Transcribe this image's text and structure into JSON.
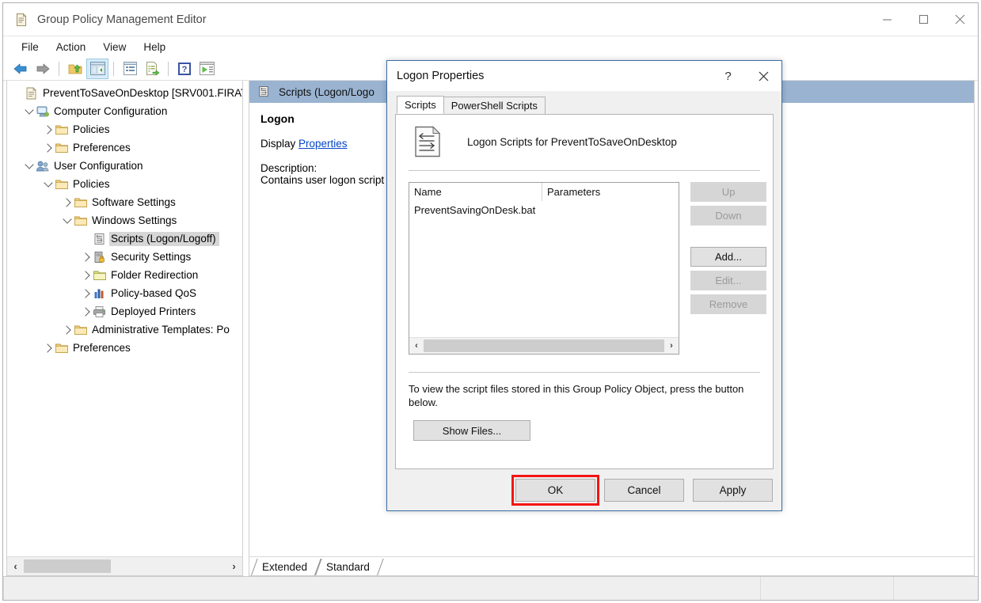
{
  "window": {
    "title": "Group Policy Management Editor",
    "icon": "policy-document-icon",
    "minimize_label": "–",
    "maximize_label": "□",
    "close_label": "✕"
  },
  "menubar": {
    "items": [
      {
        "label": "File",
        "name": "menu-file"
      },
      {
        "label": "Action",
        "name": "menu-action"
      },
      {
        "label": "View",
        "name": "menu-view"
      },
      {
        "label": "Help",
        "name": "menu-help"
      }
    ]
  },
  "toolbar": {
    "buttons": [
      {
        "name": "back-button",
        "icon": "back-arrow-icon"
      },
      {
        "name": "forward-button",
        "icon": "forward-arrow-icon"
      },
      {
        "name": "up-one-level-button",
        "icon": "up-folder-icon"
      },
      {
        "name": "show-hide-tree-button",
        "icon": "console-tree-icon"
      },
      {
        "name": "properties-button",
        "icon": "properties-window-icon"
      },
      {
        "name": "export-list-button",
        "icon": "export-list-icon"
      },
      {
        "name": "help-button",
        "icon": "help-question-icon"
      },
      {
        "name": "show-action-pane-button",
        "icon": "action-pane-icon"
      }
    ]
  },
  "tree": {
    "items": [
      {
        "label": "PreventToSaveOnDesktop [SRV001.FIRAT",
        "depth": 0,
        "twisty": "none",
        "icon": "gpo-document-icon",
        "selected": false
      },
      {
        "label": "Computer Configuration",
        "depth": 1,
        "twisty": "down",
        "icon": "computer-icon",
        "selected": false
      },
      {
        "label": "Policies",
        "depth": 2,
        "twisty": "right",
        "icon": "folder-icon",
        "selected": false
      },
      {
        "label": "Preferences",
        "depth": 2,
        "twisty": "right",
        "icon": "folder-icon",
        "selected": false
      },
      {
        "label": "User Configuration",
        "depth": 1,
        "twisty": "down",
        "icon": "users-icon",
        "selected": false
      },
      {
        "label": "Policies",
        "depth": 2,
        "twisty": "down",
        "icon": "folder-icon",
        "selected": false
      },
      {
        "label": "Software Settings",
        "depth": 3,
        "twisty": "right",
        "icon": "folder-icon",
        "selected": false
      },
      {
        "label": "Windows Settings",
        "depth": 3,
        "twisty": "down",
        "icon": "folder-icon",
        "selected": false
      },
      {
        "label": "Scripts (Logon/Logoff)",
        "depth": 4,
        "twisty": "none",
        "icon": "scripts-icon",
        "selected": true
      },
      {
        "label": "Security Settings",
        "depth": 4,
        "twisty": "right",
        "icon": "security-lock-icon",
        "selected": false
      },
      {
        "label": "Folder Redirection",
        "depth": 4,
        "twisty": "right",
        "icon": "folder-icon",
        "selected": false
      },
      {
        "label": "Policy-based QoS",
        "depth": 4,
        "twisty": "right",
        "icon": "bar-chart-icon",
        "selected": false
      },
      {
        "label": "Deployed Printers",
        "depth": 4,
        "twisty": "right",
        "icon": "printer-icon",
        "selected": false
      },
      {
        "label": "Administrative Templates: Po",
        "depth": 3,
        "twisty": "right",
        "icon": "folder-icon",
        "selected": false
      },
      {
        "label": "Preferences",
        "depth": 2,
        "twisty": "right",
        "icon": "folder-icon",
        "selected": false
      }
    ],
    "hscroll": {
      "left_arrow": "‹",
      "right_arrow": "›"
    }
  },
  "right_pane": {
    "header": {
      "title": "Scripts (Logon/Logo",
      "icon": "scripts-icon"
    },
    "content": {
      "heading": "Logon",
      "display_label": "Display",
      "display_link": "Properties",
      "description_label": "Description:",
      "description_text": "Contains user logon script"
    },
    "tabs": [
      {
        "label": "Extended",
        "name": "tab-extended"
      },
      {
        "label": "Standard",
        "name": "tab-standard"
      }
    ]
  },
  "statusbar": {
    "segments": [
      "",
      "",
      ""
    ]
  },
  "dialog": {
    "title": "Logon Properties",
    "help_label": "?",
    "close_label": "✕",
    "tabs": [
      {
        "label": "Scripts",
        "selected": true,
        "name": "tab-scripts"
      },
      {
        "label": "PowerShell Scripts",
        "selected": false,
        "name": "tab-powershell-scripts"
      }
    ],
    "script_header": {
      "icon": "script-file-icon",
      "text": "Logon Scripts for PreventToSaveOnDesktop"
    },
    "listbox": {
      "columns": [
        "Name",
        "Parameters"
      ],
      "rows": [
        {
          "name": "PreventSavingOnDesk.bat",
          "parameters": ""
        }
      ],
      "hscroll": {
        "left_arrow": "‹",
        "right_arrow": "›"
      }
    },
    "side_buttons": [
      {
        "label": "Up",
        "enabled": false,
        "name": "move-up-button"
      },
      {
        "label": "Down",
        "enabled": false,
        "name": "move-down-button"
      },
      {
        "label": "Add...",
        "enabled": true,
        "name": "add-script-button"
      },
      {
        "label": "Edit...",
        "enabled": false,
        "name": "edit-script-button"
      },
      {
        "label": "Remove",
        "enabled": false,
        "name": "remove-script-button"
      }
    ],
    "note_text": "To view the script files stored in this Group Policy Object, press the button below.",
    "show_files_label": "Show Files...",
    "footer_buttons": [
      {
        "label": "OK",
        "highlighted": true,
        "name": "ok-button"
      },
      {
        "label": "Cancel",
        "highlighted": false,
        "name": "cancel-button"
      },
      {
        "label": "Apply",
        "highlighted": false,
        "name": "apply-button"
      }
    ]
  },
  "colors": {
    "accent_blue": "#3a6ea5",
    "pane_header": "#99b3d1",
    "highlight_red": "#f51414",
    "link_blue": "#0645c8",
    "selection_grey": "#d6d6d6"
  }
}
